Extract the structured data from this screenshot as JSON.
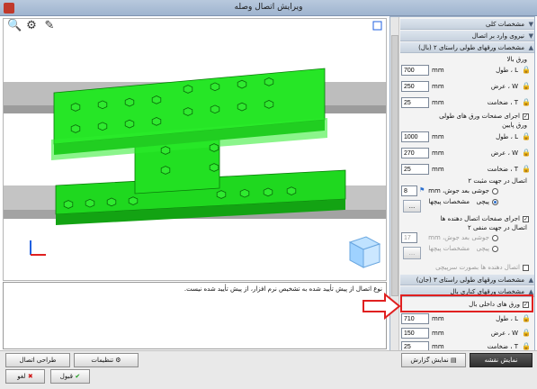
{
  "window": {
    "title": "ویرایش اتصال وصله"
  },
  "viewer": {
    "toolbar_icons": [
      "zoom-icon",
      "camera-icon",
      "tool-icon"
    ]
  },
  "message": "نوع اتصال از پیش تأیید شده به تشخیص نرم افزار، از پیش تأیید شده نیست.",
  "panel": {
    "sections": {
      "general": "مشخصات کلی",
      "forces": "نیروی وارد بر اتصال",
      "flange_plates": "مشخصات ورقهای طولی راستای ۲ (بال)",
      "web_plates": "مشخصات ورقهای طولی راستای ۳ (جان)",
      "web_plates_sub": "مشخصات ورقهای کناری بال"
    },
    "top_plate_label": "ورق بالا",
    "bottom_plate_label": "ورق پایین",
    "length_label": "L ، طول",
    "width_label": "W ، عرض",
    "thickness_label": "T ، ضخامت",
    "unit": "mm",
    "top": {
      "L": "700",
      "W": "250",
      "T": "25"
    },
    "bottom": {
      "L": "1000",
      "W": "270",
      "T": "25"
    },
    "mid": {
      "L": "710",
      "W": "150",
      "T": "25"
    },
    "chk_long_plate": "اجرای صفحات ورق های طولی",
    "conn_dir2": "اتصال در جهت مثبت ۲",
    "weld_label": "جوشی",
    "weld_length": "بعد جوش، mm",
    "weld_value": "8",
    "bolted_label": "پیچی",
    "bolt_specs": "مشخصات پیچها",
    "chk_side_plates": "اجرای صفحات اتصال دهنده ها",
    "conn_dir_neg": "اتصال در جهت منفی ۲",
    "weld_value2": "17",
    "bolt_specs2": "مشخصات پیچها",
    "conn_as_stiffener": "اتصال دهنده ها بصورت سرپیچی",
    "chk_inner_plate": "ورق های داخلی بال",
    "dots": "..."
  },
  "buttons": {
    "settings": "تنظیمات",
    "design": "طراحی اتصال",
    "report": "نمایش گزارش",
    "map": "نمایش نقشه",
    "ok": "قبول",
    "cancel": "لغو"
  },
  "colors": {
    "steel": "#26e626",
    "highlight": "#e02020",
    "axis_x": "#e02020",
    "axis_y": "#2060e0"
  }
}
